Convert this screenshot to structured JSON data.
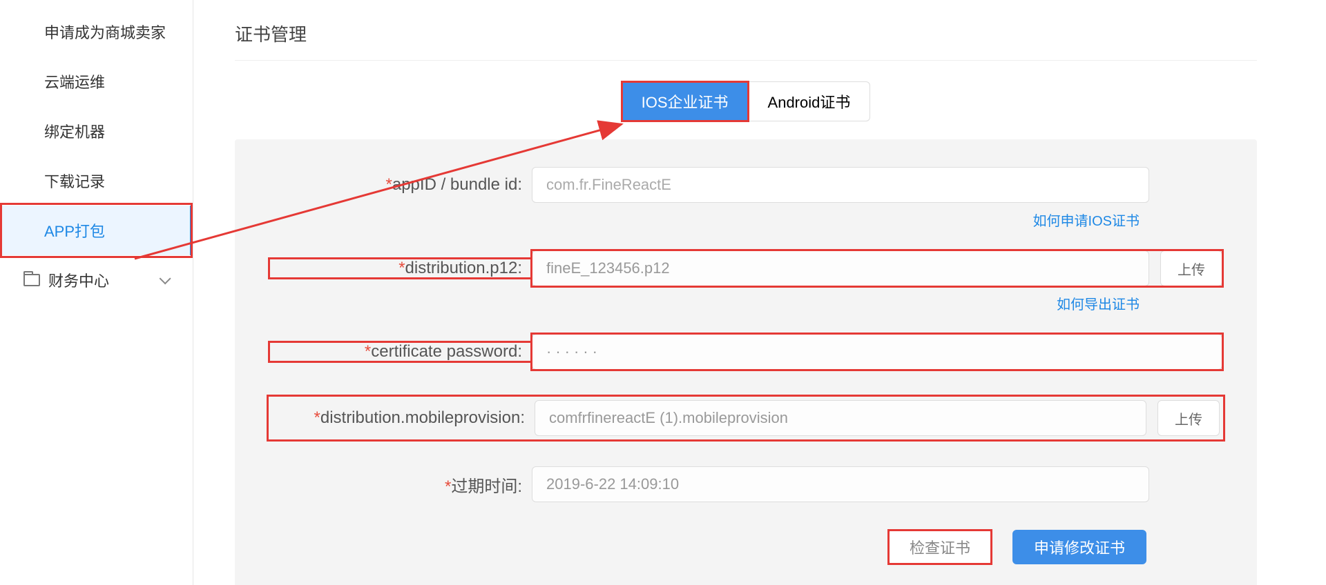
{
  "sidebar": {
    "items": [
      {
        "label": "申请成为商城卖家"
      },
      {
        "label": "云端运维"
      },
      {
        "label": "绑定机器"
      },
      {
        "label": "下载记录"
      },
      {
        "label": "APP打包"
      },
      {
        "label": "财务中心"
      }
    ]
  },
  "page": {
    "title": "证书管理"
  },
  "tabs": {
    "ios": "IOS企业证书",
    "android": "Android证书"
  },
  "form": {
    "appid_label": "appID / bundle id:",
    "appid_placeholder": "com.fr.FineReactE",
    "help_apply_ios": "如何申请IOS证书",
    "p12_label": "distribution.p12:",
    "p12_value": "fineE_123456.p12",
    "help_export_cert": "如何导出证书",
    "cert_pw_label": "certificate password:",
    "cert_pw_value": "······",
    "provision_label": "distribution.mobileprovision:",
    "provision_value": "comfrfinereactE (1).mobileprovision",
    "expire_label": "过期时间:",
    "expire_value": "2019-6-22 14:09:10",
    "upload": "上传"
  },
  "actions": {
    "check": "检查证书",
    "apply_modify": "申请修改证书"
  }
}
